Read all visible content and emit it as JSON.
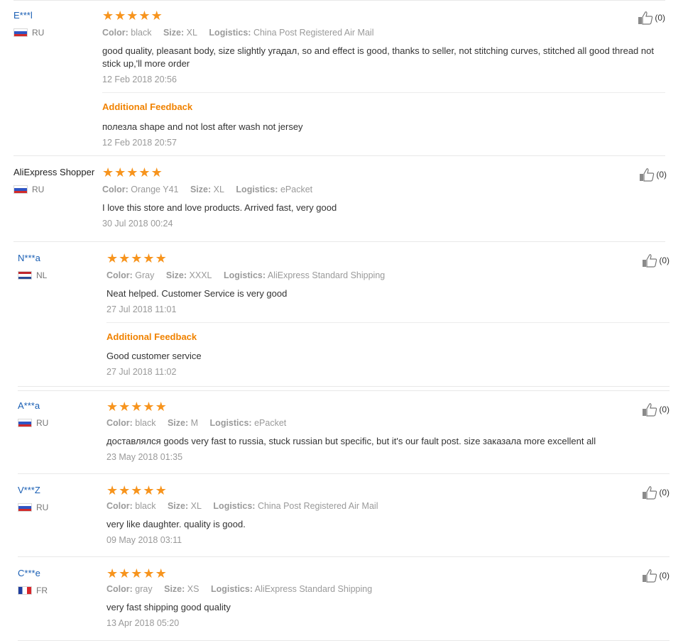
{
  "helpful_count_label": "(0)",
  "star_glyph": "★",
  "star_color": "#f7941d",
  "labels": {
    "color": "Color:",
    "size": "Size:",
    "logistics": "Logistics:",
    "additional_feedback": "Additional Feedback"
  },
  "reviews": [
    {
      "user": "E***l",
      "country": "RU",
      "rating": 5,
      "color": "black",
      "size": "XL",
      "logistics": "China Post Registered Air Mail",
      "text": "good quality, pleasant body, size slightly угадал, so and effect is good, thanks to seller, not stitching curves, stitched all good thread not stick up,'ll more order",
      "date": "12 Feb 2018 20:56",
      "additional_text": "полезла shape and not lost after wash not jersey",
      "additional_date": "12 Feb 2018 20:57",
      "helpful": "(0)"
    },
    {
      "user": "AliExpress Shopper",
      "country": "RU",
      "rating": 5,
      "color": "Orange Y41",
      "size": "XL",
      "logistics": "ePacket",
      "text": "I love this store and love products. Arrived fast, very good",
      "date": "30 Jul 2018 00:24",
      "helpful": "(0)"
    },
    {
      "user": "N***a",
      "country": "NL",
      "rating": 5,
      "color": "Gray",
      "size": "XXXL",
      "logistics": "AliExpress Standard Shipping",
      "text": "Neat helped. Customer Service is very good",
      "date": "27 Jul 2018 11:01",
      "additional_text": "Good customer service",
      "additional_date": "27 Jul 2018 11:02",
      "helpful": "(0)"
    },
    {
      "user": "A***a",
      "country": "RU",
      "rating": 5,
      "color": "black",
      "size": "M",
      "logistics": "ePacket",
      "text": "доставлялся goods very fast to russia, stuck russian but specific, but it's our fault post. size заказала more excellent all",
      "date": "23 May 2018 01:35",
      "helpful": "(0)"
    },
    {
      "user": "V***Z",
      "country": "RU",
      "rating": 5,
      "color": "black",
      "size": "XL",
      "logistics": "China Post Registered Air Mail",
      "text": "very like daughter. quality is good.",
      "date": "09 May 2018 03:11",
      "helpful": "(0)"
    },
    {
      "user": "C***e",
      "country": "FR",
      "rating": 5,
      "color": "gray",
      "size": "XS",
      "logistics": "AliExpress Standard Shipping",
      "text": "very fast shipping good quality",
      "date": "13 Apr 2018 05:20",
      "helpful": "(0)"
    }
  ]
}
